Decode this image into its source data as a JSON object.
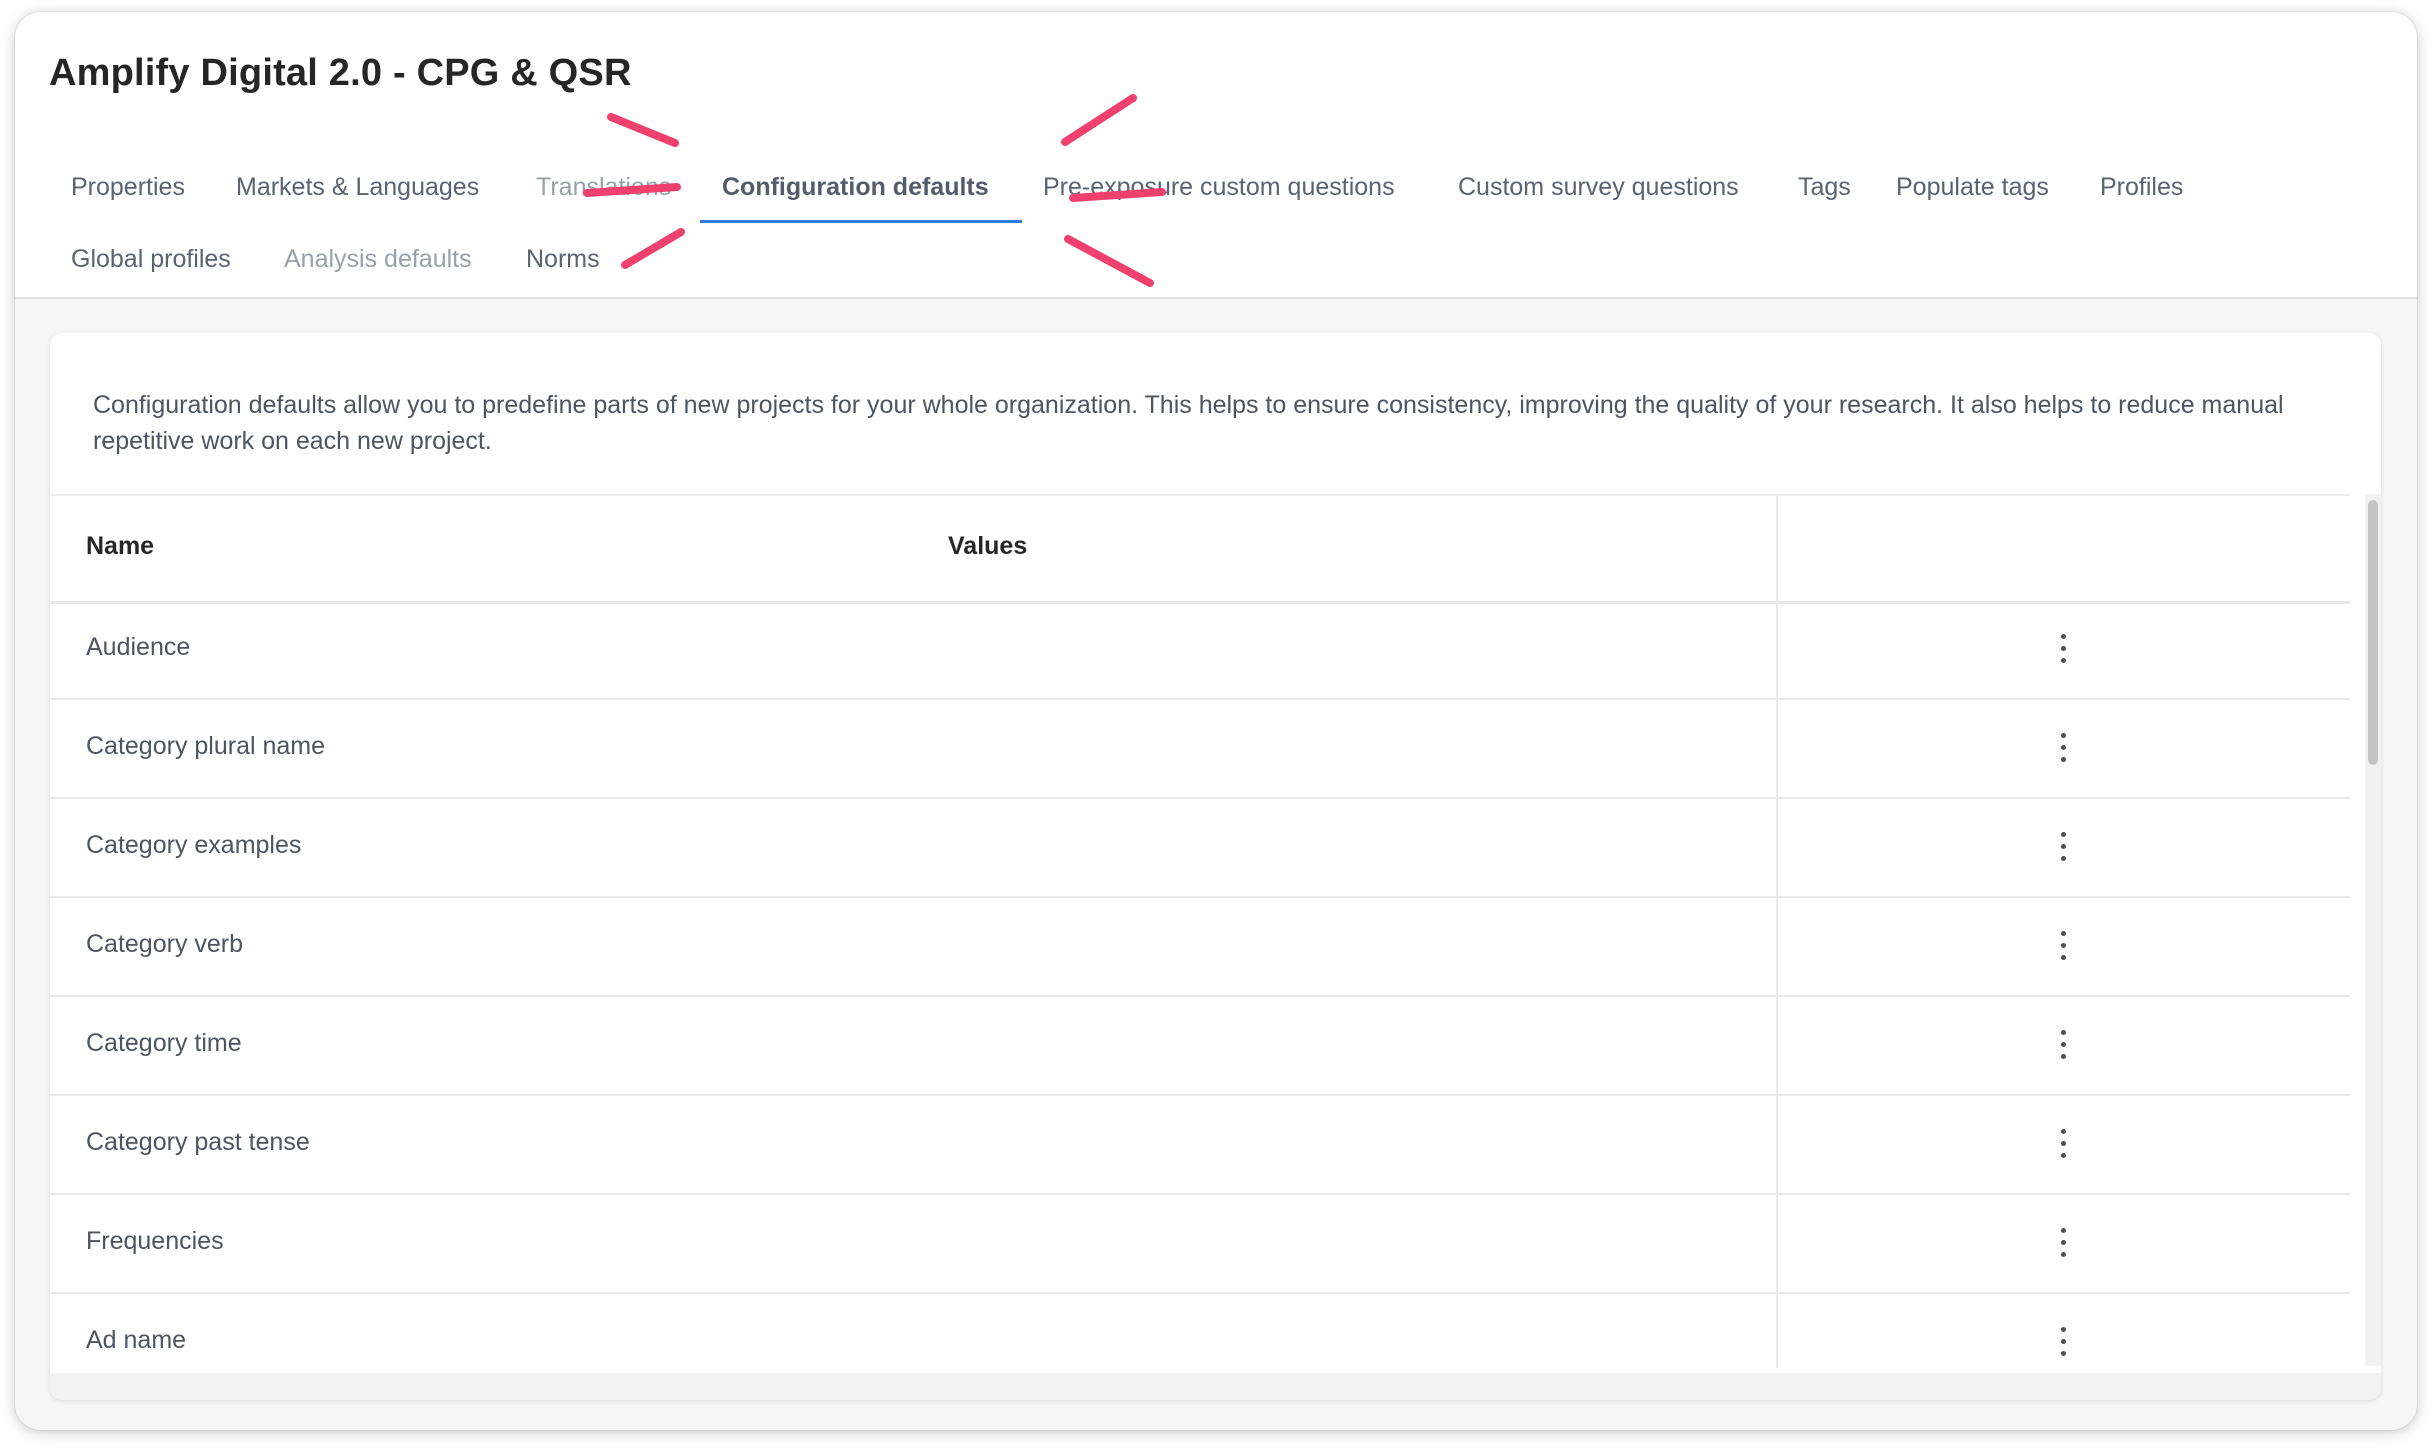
{
  "header": {
    "title": "Amplify Digital 2.0 - CPG & QSR"
  },
  "tabs": [
    {
      "label": "Properties",
      "state": "normal"
    },
    {
      "label": "Markets & Languages",
      "state": "normal"
    },
    {
      "label": "Translations",
      "state": "dimmed"
    },
    {
      "label": "Configuration defaults",
      "state": "active"
    },
    {
      "label": "Pre-exposure custom questions",
      "state": "normal"
    },
    {
      "label": "Custom survey questions",
      "state": "normal"
    },
    {
      "label": "Tags",
      "state": "normal"
    },
    {
      "label": "Populate tags",
      "state": "normal"
    },
    {
      "label": "Profiles",
      "state": "normal"
    },
    {
      "label": "Global profiles",
      "state": "normal"
    },
    {
      "label": "Analysis defaults",
      "state": "dimmed"
    },
    {
      "label": "Norms",
      "state": "normal"
    }
  ],
  "description": "Configuration defaults allow you to predefine parts of new projects for your whole organization. This helps to ensure consistency, improving the quality of your research. It also helps to reduce manual repetitive work on each new project.",
  "table": {
    "columns": [
      "Name",
      "Values",
      ""
    ],
    "rows": [
      {
        "name": "Audience",
        "value": ""
      },
      {
        "name": "Category plural name",
        "value": ""
      },
      {
        "name": "Category examples",
        "value": ""
      },
      {
        "name": "Category verb",
        "value": ""
      },
      {
        "name": "Category time",
        "value": ""
      },
      {
        "name": "Category past tense",
        "value": ""
      },
      {
        "name": "Frequencies",
        "value": ""
      },
      {
        "name": "Ad name",
        "value": ""
      }
    ],
    "row_action_icon": "more-vertical-icon"
  },
  "colors": {
    "active_tab_underline": "#2f7de1",
    "annotation_stroke": "#f0416e",
    "title_text": "#262626",
    "body_text": "#4e5460"
  }
}
